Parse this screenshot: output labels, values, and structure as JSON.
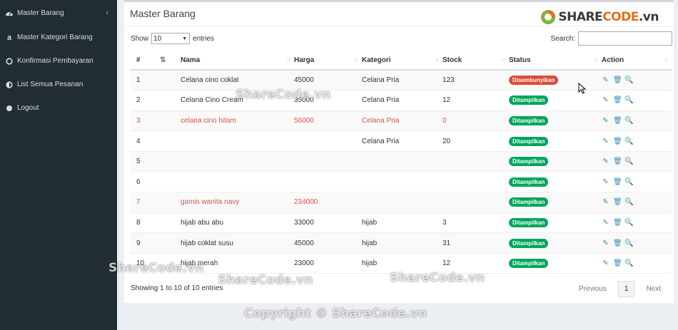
{
  "sidebar": {
    "items": [
      {
        "label": "Master Barang",
        "icon": "dashboard-icon"
      },
      {
        "label": "Master Kategori Barang",
        "icon": "amazon-icon"
      },
      {
        "label": "Konfirmasi Pembayaran",
        "icon": "circle-outline-icon"
      },
      {
        "label": "List Semua Pesanan",
        "icon": "half-circle-icon"
      },
      {
        "label": "Logout",
        "icon": "circle-icon"
      }
    ],
    "collapse": "‹"
  },
  "box": {
    "title": "Master Barang"
  },
  "length": {
    "show": "Show",
    "value": "10",
    "entries": "entries"
  },
  "search": {
    "label": "Search:"
  },
  "table": {
    "headers": [
      "#",
      "",
      "Nama",
      "Harga",
      "Kategori",
      "Stock",
      "Status",
      "Action"
    ],
    "rows": [
      {
        "no": "1",
        "nama": "Celana cino coklat",
        "harga": "45000",
        "kategori": "Celana Pria",
        "stock": "123",
        "status": "Disembunyikan"
      },
      {
        "no": "2",
        "nama": "Celana Cino Cream",
        "harga": "35000",
        "kategori": "Celana Pria",
        "stock": "12",
        "status": "Ditampilkan"
      },
      {
        "no": "3",
        "nama": "celana cino hitam",
        "harga": "56000",
        "kategori": "Celana Pria",
        "stock": "0",
        "status": "Ditampilkan"
      },
      {
        "no": "4",
        "nama": "",
        "harga": "",
        "kategori": "Celana Pria",
        "stock": "20",
        "status": "Ditampilkan"
      },
      {
        "no": "5",
        "nama": "",
        "harga": "",
        "kategori": "",
        "stock": "",
        "status": "Ditampilkan"
      },
      {
        "no": "6",
        "nama": "",
        "harga": "",
        "kategori": "",
        "stock": "",
        "status": "Ditampilkan"
      },
      {
        "no": "7",
        "nama": "gamis wanita navy",
        "harga": "234000",
        "kategori": "",
        "stock": "",
        "status": "Ditampilkan"
      },
      {
        "no": "8",
        "nama": "hijab abu abu",
        "harga": "33000",
        "kategori": "hijab",
        "stock": "3",
        "status": "Ditampilkan"
      },
      {
        "no": "9",
        "nama": "hijab coklat susu",
        "harga": "45000",
        "kategori": "hijab",
        "stock": "31",
        "status": "Ditampilkan"
      },
      {
        "no": "10",
        "nama": "hijab merah",
        "harga": "23000",
        "kategori": "hijab",
        "stock": "12",
        "status": "Ditampilkan"
      }
    ]
  },
  "footer": {
    "info": "Showing 1 to 10 of 10 entries",
    "previous": "Previous",
    "page": "1",
    "next": "Next"
  },
  "logo": {
    "brand": "SHARE",
    "accent": "CODE",
    "suffix": ".vn"
  },
  "watermarks": {
    "center": "ShareCode.vn",
    "bottom_left": "ShareCode.vn",
    "bottom_mid": "ShareCode.vn",
    "bottom_right": "ShareCode.vn",
    "copyright": "Copyright © ShareCode.vn"
  },
  "colors": {
    "sidebar_bg": "#222d32",
    "success": "#00a65a",
    "danger": "#dd4b39",
    "link": "#3c8dbc",
    "red_text": "#d9534f"
  }
}
